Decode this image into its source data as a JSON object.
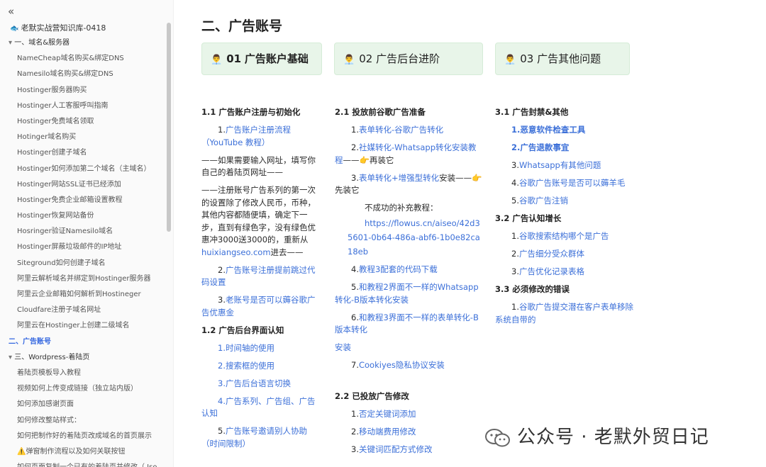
{
  "sidebar": {
    "kb_title": "老默实战营知识库-0418",
    "items": [
      {
        "label": "一、域名&服务器",
        "level": 0
      },
      {
        "label": "NameCheap域名购买&绑定DNS",
        "level": 1
      },
      {
        "label": "Namesilo域名购买&绑定DNS",
        "level": 1
      },
      {
        "label": "Hostinger服务器购买",
        "level": 1
      },
      {
        "label": "Hostinger人工客服呼叫指南",
        "level": 1
      },
      {
        "label": "Hostinger免费域名领取",
        "level": 1
      },
      {
        "label": "Hotinger域名购买",
        "level": 1
      },
      {
        "label": "Hostinger创建子域名",
        "level": 1
      },
      {
        "label": "Hostinger如何添加第二个域名（主域名）",
        "level": 1
      },
      {
        "label": "Hostinger网站SSL证书已经添加",
        "level": 1
      },
      {
        "label": "Hostinger免费企业邮箱设置教程",
        "level": 1
      },
      {
        "label": "Hostinger恢复网站备份",
        "level": 1
      },
      {
        "label": "Hosringer验证Namesilo域名",
        "level": 1
      },
      {
        "label": "Hostinger屏蔽垃圾邮件的IP地址",
        "level": 1
      },
      {
        "label": "Siteground如何创建子域名",
        "level": 1
      },
      {
        "label": "阿里云解析域名并绑定到Hostinger服务器",
        "level": 1
      },
      {
        "label": "阿里云企业邮箱如何解析到Hostineger",
        "level": 1
      },
      {
        "label": "Cloudfare注册子域名网址",
        "level": 1
      },
      {
        "label": "阿里云在Hostinger上创建二级域名",
        "level": 1
      },
      {
        "label": "二、广告账号",
        "level": 0,
        "active": true
      },
      {
        "label": "三、Wordpress-着陆页",
        "level": 0
      },
      {
        "label": "着陆页模板导入教程",
        "level": 1
      },
      {
        "label": "视频如何上传变成链接（独立站内版）",
        "level": 1
      },
      {
        "label": "如何添加感谢页面",
        "level": 1
      },
      {
        "label": "如何修改整站样式：",
        "level": 1
      },
      {
        "label": "如何把制作好的着陆页改成域名的首页展示",
        "level": 1
      },
      {
        "label": "⚠️弹窗制作流程以及如何关联按钮",
        "level": 1
      },
      {
        "label": "如何页面复制一个已有的着陆页并修改（.Jso...",
        "level": 1
      }
    ]
  },
  "main": {
    "title": "二、广告账号",
    "cards": [
      {
        "icon": "👨‍💼",
        "num": "01",
        "label": "广告账户基础",
        "bold": true
      },
      {
        "icon": "👨‍💼",
        "num": "02",
        "label": "广告后台进阶",
        "bold": false
      },
      {
        "icon": "👨‍💼",
        "num": "03",
        "label": "广告其他问题",
        "bold": false
      }
    ],
    "col1": {
      "s1": "1.1 广告账户注册与初始化",
      "l1a": "1.",
      "l1b": "广告账户注册流程（YouTube 教程）",
      "t1": "——如果需要输入网址，填写你自己的着陆页网址——",
      "t2a": "——注册账号广告系列的第一次的设置除了修改人民币，币种，其他内容都随便填，确定下一步，直到有绿色字，没有绿色优惠冲3000送3000的，重新从",
      "t2link": "huixiangseo.com",
      "t2b": "进去——",
      "l2a": "2.",
      "l2b": "广告账号注册提前跳过代码设置",
      "l3a": "3.",
      "l3b": "老账号是否可以薅谷歌广告优惠金",
      "s2": "1.2 广告后台界面认知",
      "l4": "1.时间轴的使用",
      "l5": "2.搜索框的使用",
      "l6": "3.广告后台语言切换",
      "l7": "4.广告系列、广告组、广告认知",
      "l8a": "5.",
      "l8b": "广告账号邀请别人协助（时间限制）"
    },
    "col2": {
      "s1": "2.1 投放前谷歌广告准备",
      "a1n": "1.",
      "a1": "表单转化-谷歌广告转化",
      "a2n": "2.",
      "a2": "社媒转化-Whatsapp转化安装教程",
      "a2t": "——👉再装它",
      "a3n": "3.",
      "a3": "表单转化+增强型转化",
      "a3t": "安装——👉先装它",
      "fail": "不成功的补充教程：",
      "faillink": "https://flowus.cn/aiseo/42d35601-0b64-486a-abf6-1b0e82ca18eb",
      "a4n": "4.",
      "a4": "教程3配套的代码下载",
      "a5n": "5.",
      "a5": "和教程2界面不一样的Whatsapp转化-B版本转化安装",
      "a6n": "6.",
      "a6": "和教程3界面不一样的表单转化-B版本转化",
      "a6c": "安装",
      "a7n": "7.",
      "a7": "Cookiyes隐私协议安装",
      "s2": "2.2 已投放广告修改",
      "b1n": "1.",
      "b1": "否定关键词添加",
      "b2n": "2.",
      "b2": "移动端费用修改",
      "b3n": "3.",
      "b3": "关键词匹配方式修改"
    },
    "col3": {
      "s1": "3.1 广告封禁&其他",
      "c1": "1.恶意软件检查工具",
      "c2": "2.广告退款事宜",
      "c3n": "3.",
      "c3": "Whatsapp有其他问题",
      "c4n": "4.",
      "c4": "谷歌广告账号是否可以薅羊毛",
      "c5n": "5.",
      "c5": "谷歌广告注销",
      "s2": "3.2 广告认知增长",
      "d1n": "1.",
      "d1": "谷歌搜索结构哪个是广告",
      "d2n": "2.",
      "d2": "广告细分受众群体",
      "d3n": "3.",
      "d3": "广告优化记录表格",
      "s3": "3.3 必须修改的错误",
      "e1n": "1.",
      "e1": "谷歌广告提交潜在客户表单移除系统自带的"
    }
  },
  "watermark": {
    "text": "公众号 · 老默外贸日记"
  },
  "colors": {
    "link": "#3b6fd8",
    "active": "#3366e0",
    "card_bg": "#e8f5e9"
  }
}
